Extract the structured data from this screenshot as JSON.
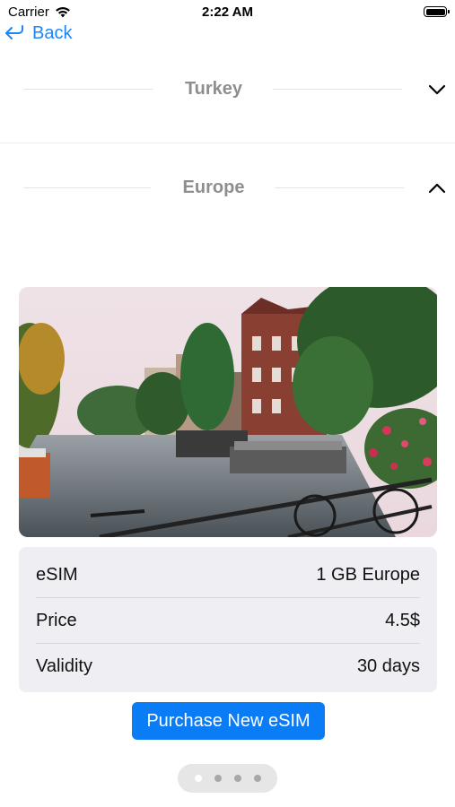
{
  "status_bar": {
    "carrier": "Carrier",
    "time": "2:22 AM",
    "wifi_icon": "wifi-icon",
    "battery_icon": "battery-full-icon"
  },
  "nav": {
    "back_label": "Back",
    "back_icon": "back-arrow-icon"
  },
  "sections": [
    {
      "title": "Turkey",
      "expanded": false,
      "chevron_icon": "chevron-down-icon"
    },
    {
      "title": "Europe",
      "expanded": true,
      "chevron_icon": "chevron-up-icon"
    }
  ],
  "plan": {
    "image_icon": "amsterdam-canal-photo",
    "rows": [
      {
        "label": "eSIM",
        "value": "1 GB Europe"
      },
      {
        "label": "Price",
        "value": "4.5$"
      },
      {
        "label": "Validity",
        "value": "30 days"
      }
    ]
  },
  "purchase_button_label": "Purchase New eSIM",
  "pager": {
    "total": 4,
    "current": 1
  },
  "colors": {
    "accent": "#0a7cf5",
    "link": "#1b86f7",
    "section_title": "#8e8e8e",
    "card_bg": "#efeff3"
  }
}
